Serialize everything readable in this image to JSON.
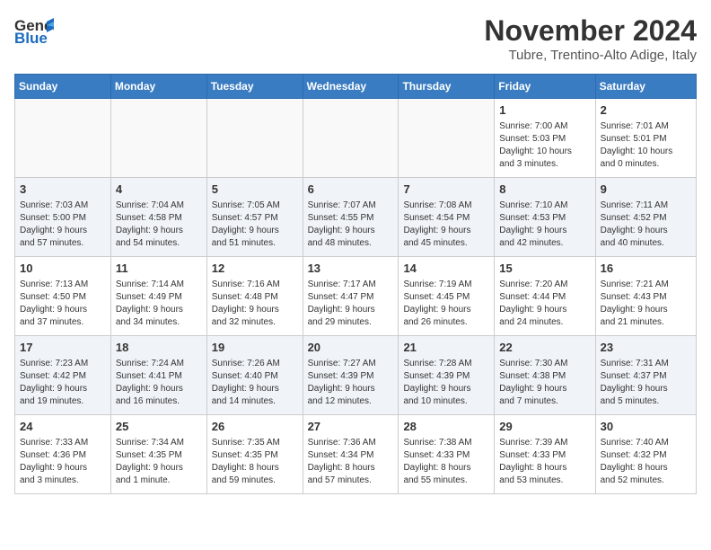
{
  "header": {
    "logo_line1": "General",
    "logo_line2": "Blue",
    "month_year": "November 2024",
    "location": "Tubre, Trentino-Alto Adige, Italy"
  },
  "weekdays": [
    "Sunday",
    "Monday",
    "Tuesday",
    "Wednesday",
    "Thursday",
    "Friday",
    "Saturday"
  ],
  "weeks": [
    [
      {
        "day": "",
        "info": ""
      },
      {
        "day": "",
        "info": ""
      },
      {
        "day": "",
        "info": ""
      },
      {
        "day": "",
        "info": ""
      },
      {
        "day": "",
        "info": ""
      },
      {
        "day": "1",
        "info": "Sunrise: 7:00 AM\nSunset: 5:03 PM\nDaylight: 10 hours\nand 3 minutes."
      },
      {
        "day": "2",
        "info": "Sunrise: 7:01 AM\nSunset: 5:01 PM\nDaylight: 10 hours\nand 0 minutes."
      }
    ],
    [
      {
        "day": "3",
        "info": "Sunrise: 7:03 AM\nSunset: 5:00 PM\nDaylight: 9 hours\nand 57 minutes."
      },
      {
        "day": "4",
        "info": "Sunrise: 7:04 AM\nSunset: 4:58 PM\nDaylight: 9 hours\nand 54 minutes."
      },
      {
        "day": "5",
        "info": "Sunrise: 7:05 AM\nSunset: 4:57 PM\nDaylight: 9 hours\nand 51 minutes."
      },
      {
        "day": "6",
        "info": "Sunrise: 7:07 AM\nSunset: 4:55 PM\nDaylight: 9 hours\nand 48 minutes."
      },
      {
        "day": "7",
        "info": "Sunrise: 7:08 AM\nSunset: 4:54 PM\nDaylight: 9 hours\nand 45 minutes."
      },
      {
        "day": "8",
        "info": "Sunrise: 7:10 AM\nSunset: 4:53 PM\nDaylight: 9 hours\nand 42 minutes."
      },
      {
        "day": "9",
        "info": "Sunrise: 7:11 AM\nSunset: 4:52 PM\nDaylight: 9 hours\nand 40 minutes."
      }
    ],
    [
      {
        "day": "10",
        "info": "Sunrise: 7:13 AM\nSunset: 4:50 PM\nDaylight: 9 hours\nand 37 minutes."
      },
      {
        "day": "11",
        "info": "Sunrise: 7:14 AM\nSunset: 4:49 PM\nDaylight: 9 hours\nand 34 minutes."
      },
      {
        "day": "12",
        "info": "Sunrise: 7:16 AM\nSunset: 4:48 PM\nDaylight: 9 hours\nand 32 minutes."
      },
      {
        "day": "13",
        "info": "Sunrise: 7:17 AM\nSunset: 4:47 PM\nDaylight: 9 hours\nand 29 minutes."
      },
      {
        "day": "14",
        "info": "Sunrise: 7:19 AM\nSunset: 4:45 PM\nDaylight: 9 hours\nand 26 minutes."
      },
      {
        "day": "15",
        "info": "Sunrise: 7:20 AM\nSunset: 4:44 PM\nDaylight: 9 hours\nand 24 minutes."
      },
      {
        "day": "16",
        "info": "Sunrise: 7:21 AM\nSunset: 4:43 PM\nDaylight: 9 hours\nand 21 minutes."
      }
    ],
    [
      {
        "day": "17",
        "info": "Sunrise: 7:23 AM\nSunset: 4:42 PM\nDaylight: 9 hours\nand 19 minutes."
      },
      {
        "day": "18",
        "info": "Sunrise: 7:24 AM\nSunset: 4:41 PM\nDaylight: 9 hours\nand 16 minutes."
      },
      {
        "day": "19",
        "info": "Sunrise: 7:26 AM\nSunset: 4:40 PM\nDaylight: 9 hours\nand 14 minutes."
      },
      {
        "day": "20",
        "info": "Sunrise: 7:27 AM\nSunset: 4:39 PM\nDaylight: 9 hours\nand 12 minutes."
      },
      {
        "day": "21",
        "info": "Sunrise: 7:28 AM\nSunset: 4:39 PM\nDaylight: 9 hours\nand 10 minutes."
      },
      {
        "day": "22",
        "info": "Sunrise: 7:30 AM\nSunset: 4:38 PM\nDaylight: 9 hours\nand 7 minutes."
      },
      {
        "day": "23",
        "info": "Sunrise: 7:31 AM\nSunset: 4:37 PM\nDaylight: 9 hours\nand 5 minutes."
      }
    ],
    [
      {
        "day": "24",
        "info": "Sunrise: 7:33 AM\nSunset: 4:36 PM\nDaylight: 9 hours\nand 3 minutes."
      },
      {
        "day": "25",
        "info": "Sunrise: 7:34 AM\nSunset: 4:35 PM\nDaylight: 9 hours\nand 1 minute."
      },
      {
        "day": "26",
        "info": "Sunrise: 7:35 AM\nSunset: 4:35 PM\nDaylight: 8 hours\nand 59 minutes."
      },
      {
        "day": "27",
        "info": "Sunrise: 7:36 AM\nSunset: 4:34 PM\nDaylight: 8 hours\nand 57 minutes."
      },
      {
        "day": "28",
        "info": "Sunrise: 7:38 AM\nSunset: 4:33 PM\nDaylight: 8 hours\nand 55 minutes."
      },
      {
        "day": "29",
        "info": "Sunrise: 7:39 AM\nSunset: 4:33 PM\nDaylight: 8 hours\nand 53 minutes."
      },
      {
        "day": "30",
        "info": "Sunrise: 7:40 AM\nSunset: 4:32 PM\nDaylight: 8 hours\nand 52 minutes."
      }
    ]
  ]
}
